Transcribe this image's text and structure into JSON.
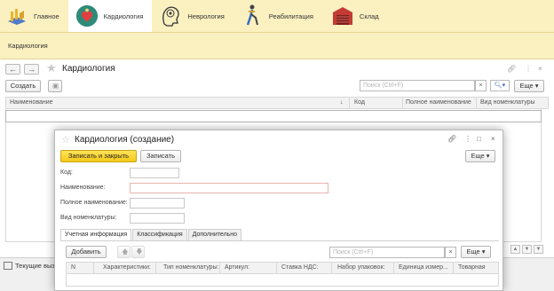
{
  "sections": [
    {
      "label": "Главное",
      "icon": "home-icon",
      "active": false
    },
    {
      "label": "Кардиология",
      "icon": "heart-icon",
      "active": true
    },
    {
      "label": "Неврология",
      "icon": "brain-icon",
      "active": false
    },
    {
      "label": "Реабилитация",
      "icon": "rehab-icon",
      "active": false
    },
    {
      "label": "Склад",
      "icon": "warehouse-icon",
      "active": false
    }
  ],
  "open_windows": {
    "tab": "Кардиология"
  },
  "list": {
    "title": "Кардиология",
    "create_label": "Создать",
    "search_placeholder": "Поиск (Ctrl+F)",
    "clear_label": "×",
    "more_label": "Еще",
    "columns": [
      "Наименование",
      "Код",
      "Полное наименование",
      "Вид номенклатуры"
    ]
  },
  "statusbar": {
    "label": "Текущие вызовы"
  },
  "dialog": {
    "title": "Кардиология (создание)",
    "save_close_label": "Записать и закрыть",
    "save_label": "Записать",
    "more_label": "Еще",
    "fields": {
      "code": "Код:",
      "name": "Наименование:",
      "full_name": "Полное наименование:",
      "kind": "Вид номенклатуры:"
    },
    "tabs": [
      "Учетная информация",
      "Классификация",
      "Дополнительно"
    ],
    "add_label": "Добавить",
    "search_placeholder": "Поиск (Ctrl+F)",
    "clear_label": "×",
    "table_columns": [
      "N",
      "Характеристики:",
      "Тип номенклатуры:",
      "Артикул:",
      "Ставка НДС:",
      "Набор упаковок:",
      "Единица измер...",
      "Товарная"
    ]
  },
  "colors": {
    "sections_bg": "#fbf0c0",
    "accent_yellow": "#f5ca16"
  }
}
